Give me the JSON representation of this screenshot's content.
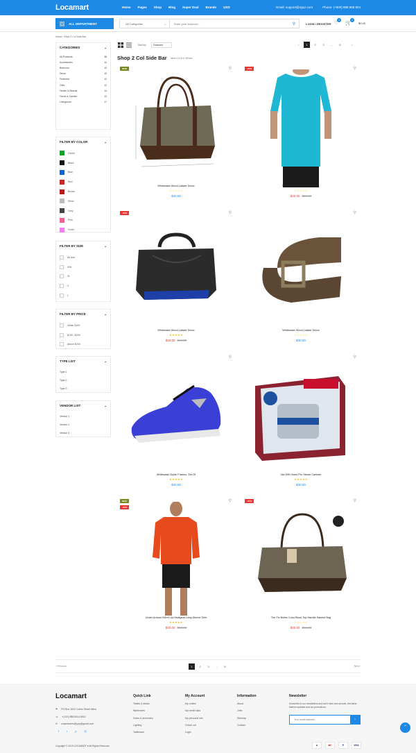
{
  "header": {
    "logo": "Locamart",
    "nav": [
      "Home",
      "Pages",
      "Shop",
      "Blog",
      "Super Deal",
      "Brands",
      "USD"
    ],
    "email": "Email: support@nguz.com",
    "phone": "Phone: (+800) 888 888 904",
    "all_department": "ALL DEPARTMENT",
    "category_select": "All Categories",
    "search_placeholder": "Enter your keyword...",
    "login": "LOGIN / REGISTER",
    "wishlist_count": "0",
    "cart_count": "0",
    "cart_total": "$0.00"
  },
  "breadcrumb": "Home / Shop 2 Col Side Bar",
  "sidebar": {
    "categories_title": "CATEGORIES",
    "categories": [
      {
        "name": "All Products",
        "count": "38"
      },
      {
        "name": "Accessories",
        "count": "14"
      },
      {
        "name": "Bedroom",
        "count": "13"
      },
      {
        "name": "Decor",
        "count": "15"
      },
      {
        "name": "Featured",
        "count": "12"
      },
      {
        "name": "Gifts",
        "count": "12"
      },
      {
        "name": "Health & Beauty",
        "count": "14"
      },
      {
        "name": "Home & Garden",
        "count": "13"
      },
      {
        "name": "Livingroom",
        "count": "17"
      }
    ],
    "color_title": "FILTER BY COLOR",
    "colors": [
      {
        "name": "Green",
        "hex": "#12a12b"
      },
      {
        "name": "Black",
        "hex": "#111111"
      },
      {
        "name": "Blue",
        "hex": "#1565c0"
      },
      {
        "name": "Red",
        "hex": "#c62828"
      },
      {
        "name": "Brown",
        "hex": "#b71c1c"
      },
      {
        "name": "Silver",
        "hex": "#bdbdbd"
      },
      {
        "name": "Grey",
        "hex": "#444444"
      },
      {
        "name": "Pink",
        "hex": "#f06292"
      },
      {
        "name": "Violet",
        "hex": "#ee82ee"
      }
    ],
    "size_title": "FILTER BY SIZE",
    "sizes": [
      "All size",
      "S/M",
      "XL",
      "X",
      "L"
    ],
    "price_title": "FILTER BY PRICE",
    "prices": [
      "Under $100",
      "$100 - $200",
      "Above $200"
    ],
    "type_title": "TYPE LIST",
    "types": [
      "Type 1",
      "Type 2",
      "Type 3"
    ],
    "vendor_title": "VENDOR LIST",
    "vendors": [
      "Vendor 1",
      "Vendor 2",
      "Vendor 3"
    ]
  },
  "toolbar": {
    "sort_label": "Sort by:",
    "sort_value": "Featured",
    "pages": [
      "1",
      "2",
      "3",
      "...",
      "6"
    ],
    "title": "Shop 2 Col Side Bar",
    "items_text": "Items 1 to 8 of 38 total"
  },
  "products": [
    {
      "name": "Whitewash Wood Ladder Decor",
      "price": "$40.00",
      "old_price": "",
      "tag": "NEW",
      "tag2": "",
      "stars": "☆☆☆☆☆"
    },
    {
      "name": "Whitewash Wood Ladder Decor",
      "price": "$40.00",
      "old_price": "$60.00",
      "tag": "-10%",
      "tag2": "",
      "stars": "☆☆☆☆☆"
    },
    {
      "name": "Whitewash Wood Ladder Decor",
      "price": "$40.00",
      "old_price": "$60.00",
      "tag": "-10%",
      "tag2": "",
      "stars": "★★★★★"
    },
    {
      "name": "Whitewash Wood Ladder Decor",
      "price": "$40.00",
      "old_price": "",
      "tag": "",
      "tag2": "",
      "stars": "☆☆☆☆☆"
    },
    {
      "name": "Whitewash Dylan Frames, Set Of",
      "price": "$40.00",
      "old_price": "",
      "tag": "",
      "tag2": "",
      "stars": "★★★★★"
    },
    {
      "name": "Vax 595 Home Pro Steam Canister",
      "price": "$40.00",
      "old_price": "",
      "tag": "",
      "tag2": "",
      "stars": "★★★★★"
    },
    {
      "name": "Under Armour Men's Ua Heatgear Long-Sleeve Shirt",
      "price": "$40.00",
      "old_price": "$60.00",
      "tag": "NEW",
      "tag2": "-10%",
      "stars": "★★★★★"
    },
    {
      "name": "The Fix Bolles Color Block Top Handle Satchel Bag",
      "price": "$40.00",
      "old_price": "$60.00",
      "tag": "-10%",
      "tag2": "",
      "stars": "☆☆☆☆☆"
    }
  ],
  "bottom_pager": {
    "prev": "Previous",
    "next": "Next",
    "pages": [
      "1",
      "2",
      "3",
      "...",
      "6"
    ]
  },
  "footer": {
    "logo": "Locamart",
    "address": "PO Box 1622 Colins Street West",
    "phone": "+(100) 888 8914 8901",
    "email": "cmsmasters@yay@gmail.com",
    "quick_title": "Quick Link",
    "quick": [
      "Tables & desks",
      "Wardrobes",
      "Sofas & armchairs",
      "Lighting",
      "Tableware"
    ],
    "account_title": "My Account",
    "account": [
      "My orders",
      "My credit slips",
      "My personal info",
      "Check out",
      "Login"
    ],
    "info_title": "Information",
    "info": [
      "About",
      "Jobs",
      "Sitemap",
      "Contact"
    ],
    "news_title": "Newsletter",
    "news_text": "Subscribe to our newsletters and don't miss new arrivals, the latest fashion updates and our promotions.",
    "news_placeholder": "Your email address",
    "copyright": "Copyright © 2019 LOCAMART ♥ All Rights Reserved.",
    "payments": [
      "a",
      "MC",
      "P",
      "VISA"
    ]
  },
  "accent": "#1e88e5"
}
